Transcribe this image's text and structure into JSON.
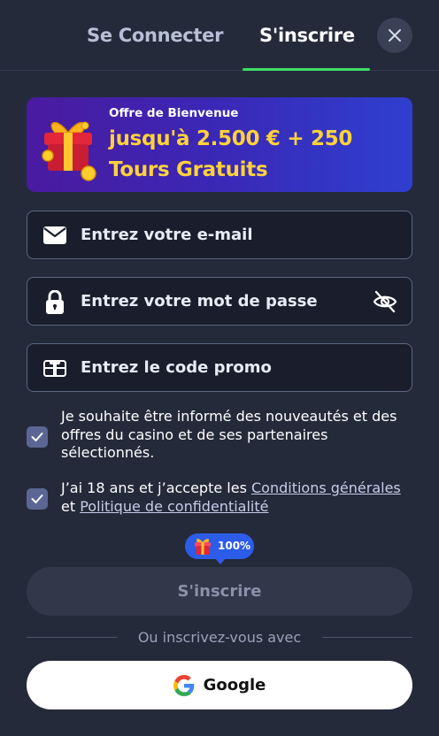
{
  "tabs": {
    "login_label": "Se Connecter",
    "signup_label": "S'inscrire",
    "active": "signup"
  },
  "banner": {
    "small_text": "Offre de Bienvenue",
    "big_text": "jusqu'à 2.500 € + 250 Tours Gratuits",
    "icon": "gift-icon"
  },
  "form": {
    "email_placeholder": "Entrez votre e-mail",
    "password_placeholder": "Entrez votre mot de passe",
    "promo_placeholder": "Entrez le code promo",
    "email_value": "",
    "password_value": "",
    "promo_value": ""
  },
  "checkboxes": {
    "newsletter": {
      "checked": true,
      "text": "Je souhaite être informé des nouveautés et des offres du casino et de ses partenaires sélectionnés."
    },
    "terms": {
      "checked": true,
      "text_prefix": "J’ai 18 ans et j’accepte les ",
      "link1": "Conditions générales",
      "text_mid": " et ",
      "link2": "Politique de confidentialité"
    }
  },
  "progress": {
    "label": "100%",
    "value": 1.0
  },
  "submit_label": "S'inscrire",
  "divider_text": "Ou inscrivez-vous avec",
  "google_label": "Google",
  "colors": {
    "background": "#252a3a",
    "accent_green": "#3ddc68",
    "banner_text": "#ffd23a",
    "badge_blue": "#2d5ce8",
    "checkbox": "#5b6694"
  }
}
